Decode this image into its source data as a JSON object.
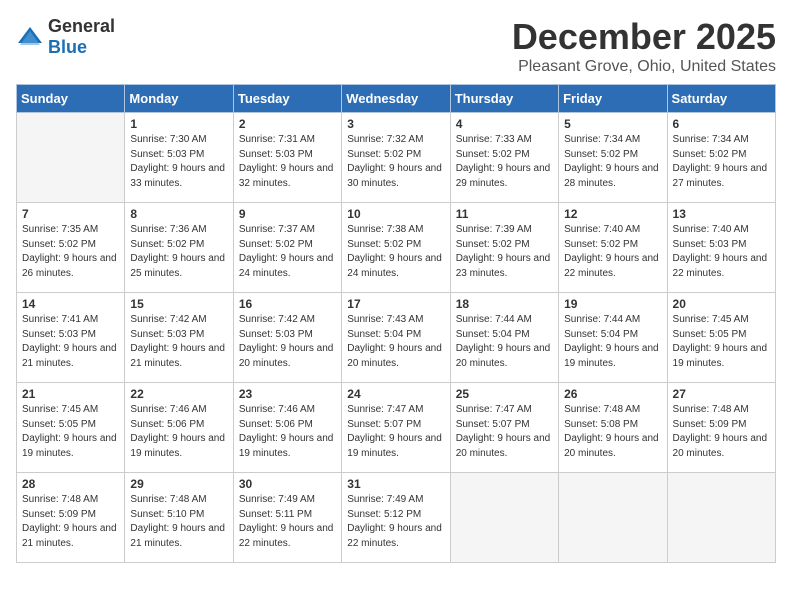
{
  "logo": {
    "general": "General",
    "blue": "Blue"
  },
  "header": {
    "month": "December 2025",
    "location": "Pleasant Grove, Ohio, United States"
  },
  "weekdays": [
    "Sunday",
    "Monday",
    "Tuesday",
    "Wednesday",
    "Thursday",
    "Friday",
    "Saturday"
  ],
  "weeks": [
    [
      {
        "day": "",
        "empty": true
      },
      {
        "day": "1",
        "sunrise": "7:30 AM",
        "sunset": "5:03 PM",
        "daylight": "9 hours and 33 minutes."
      },
      {
        "day": "2",
        "sunrise": "7:31 AM",
        "sunset": "5:03 PM",
        "daylight": "9 hours and 32 minutes."
      },
      {
        "day": "3",
        "sunrise": "7:32 AM",
        "sunset": "5:02 PM",
        "daylight": "9 hours and 30 minutes."
      },
      {
        "day": "4",
        "sunrise": "7:33 AM",
        "sunset": "5:02 PM",
        "daylight": "9 hours and 29 minutes."
      },
      {
        "day": "5",
        "sunrise": "7:34 AM",
        "sunset": "5:02 PM",
        "daylight": "9 hours and 28 minutes."
      },
      {
        "day": "6",
        "sunrise": "7:34 AM",
        "sunset": "5:02 PM",
        "daylight": "9 hours and 27 minutes."
      }
    ],
    [
      {
        "day": "7",
        "sunrise": "7:35 AM",
        "sunset": "5:02 PM",
        "daylight": "9 hours and 26 minutes."
      },
      {
        "day": "8",
        "sunrise": "7:36 AM",
        "sunset": "5:02 PM",
        "daylight": "9 hours and 25 minutes."
      },
      {
        "day": "9",
        "sunrise": "7:37 AM",
        "sunset": "5:02 PM",
        "daylight": "9 hours and 24 minutes."
      },
      {
        "day": "10",
        "sunrise": "7:38 AM",
        "sunset": "5:02 PM",
        "daylight": "9 hours and 24 minutes."
      },
      {
        "day": "11",
        "sunrise": "7:39 AM",
        "sunset": "5:02 PM",
        "daylight": "9 hours and 23 minutes."
      },
      {
        "day": "12",
        "sunrise": "7:40 AM",
        "sunset": "5:02 PM",
        "daylight": "9 hours and 22 minutes."
      },
      {
        "day": "13",
        "sunrise": "7:40 AM",
        "sunset": "5:03 PM",
        "daylight": "9 hours and 22 minutes."
      }
    ],
    [
      {
        "day": "14",
        "sunrise": "7:41 AM",
        "sunset": "5:03 PM",
        "daylight": "9 hours and 21 minutes."
      },
      {
        "day": "15",
        "sunrise": "7:42 AM",
        "sunset": "5:03 PM",
        "daylight": "9 hours and 21 minutes."
      },
      {
        "day": "16",
        "sunrise": "7:42 AM",
        "sunset": "5:03 PM",
        "daylight": "9 hours and 20 minutes."
      },
      {
        "day": "17",
        "sunrise": "7:43 AM",
        "sunset": "5:04 PM",
        "daylight": "9 hours and 20 minutes."
      },
      {
        "day": "18",
        "sunrise": "7:44 AM",
        "sunset": "5:04 PM",
        "daylight": "9 hours and 20 minutes."
      },
      {
        "day": "19",
        "sunrise": "7:44 AM",
        "sunset": "5:04 PM",
        "daylight": "9 hours and 19 minutes."
      },
      {
        "day": "20",
        "sunrise": "7:45 AM",
        "sunset": "5:05 PM",
        "daylight": "9 hours and 19 minutes."
      }
    ],
    [
      {
        "day": "21",
        "sunrise": "7:45 AM",
        "sunset": "5:05 PM",
        "daylight": "9 hours and 19 minutes."
      },
      {
        "day": "22",
        "sunrise": "7:46 AM",
        "sunset": "5:06 PM",
        "daylight": "9 hours and 19 minutes."
      },
      {
        "day": "23",
        "sunrise": "7:46 AM",
        "sunset": "5:06 PM",
        "daylight": "9 hours and 19 minutes."
      },
      {
        "day": "24",
        "sunrise": "7:47 AM",
        "sunset": "5:07 PM",
        "daylight": "9 hours and 19 minutes."
      },
      {
        "day": "25",
        "sunrise": "7:47 AM",
        "sunset": "5:07 PM",
        "daylight": "9 hours and 20 minutes."
      },
      {
        "day": "26",
        "sunrise": "7:48 AM",
        "sunset": "5:08 PM",
        "daylight": "9 hours and 20 minutes."
      },
      {
        "day": "27",
        "sunrise": "7:48 AM",
        "sunset": "5:09 PM",
        "daylight": "9 hours and 20 minutes."
      }
    ],
    [
      {
        "day": "28",
        "sunrise": "7:48 AM",
        "sunset": "5:09 PM",
        "daylight": "9 hours and 21 minutes."
      },
      {
        "day": "29",
        "sunrise": "7:48 AM",
        "sunset": "5:10 PM",
        "daylight": "9 hours and 21 minutes."
      },
      {
        "day": "30",
        "sunrise": "7:49 AM",
        "sunset": "5:11 PM",
        "daylight": "9 hours and 22 minutes."
      },
      {
        "day": "31",
        "sunrise": "7:49 AM",
        "sunset": "5:12 PM",
        "daylight": "9 hours and 22 minutes."
      },
      {
        "day": "",
        "empty": true
      },
      {
        "day": "",
        "empty": true
      },
      {
        "day": "",
        "empty": true
      }
    ]
  ]
}
